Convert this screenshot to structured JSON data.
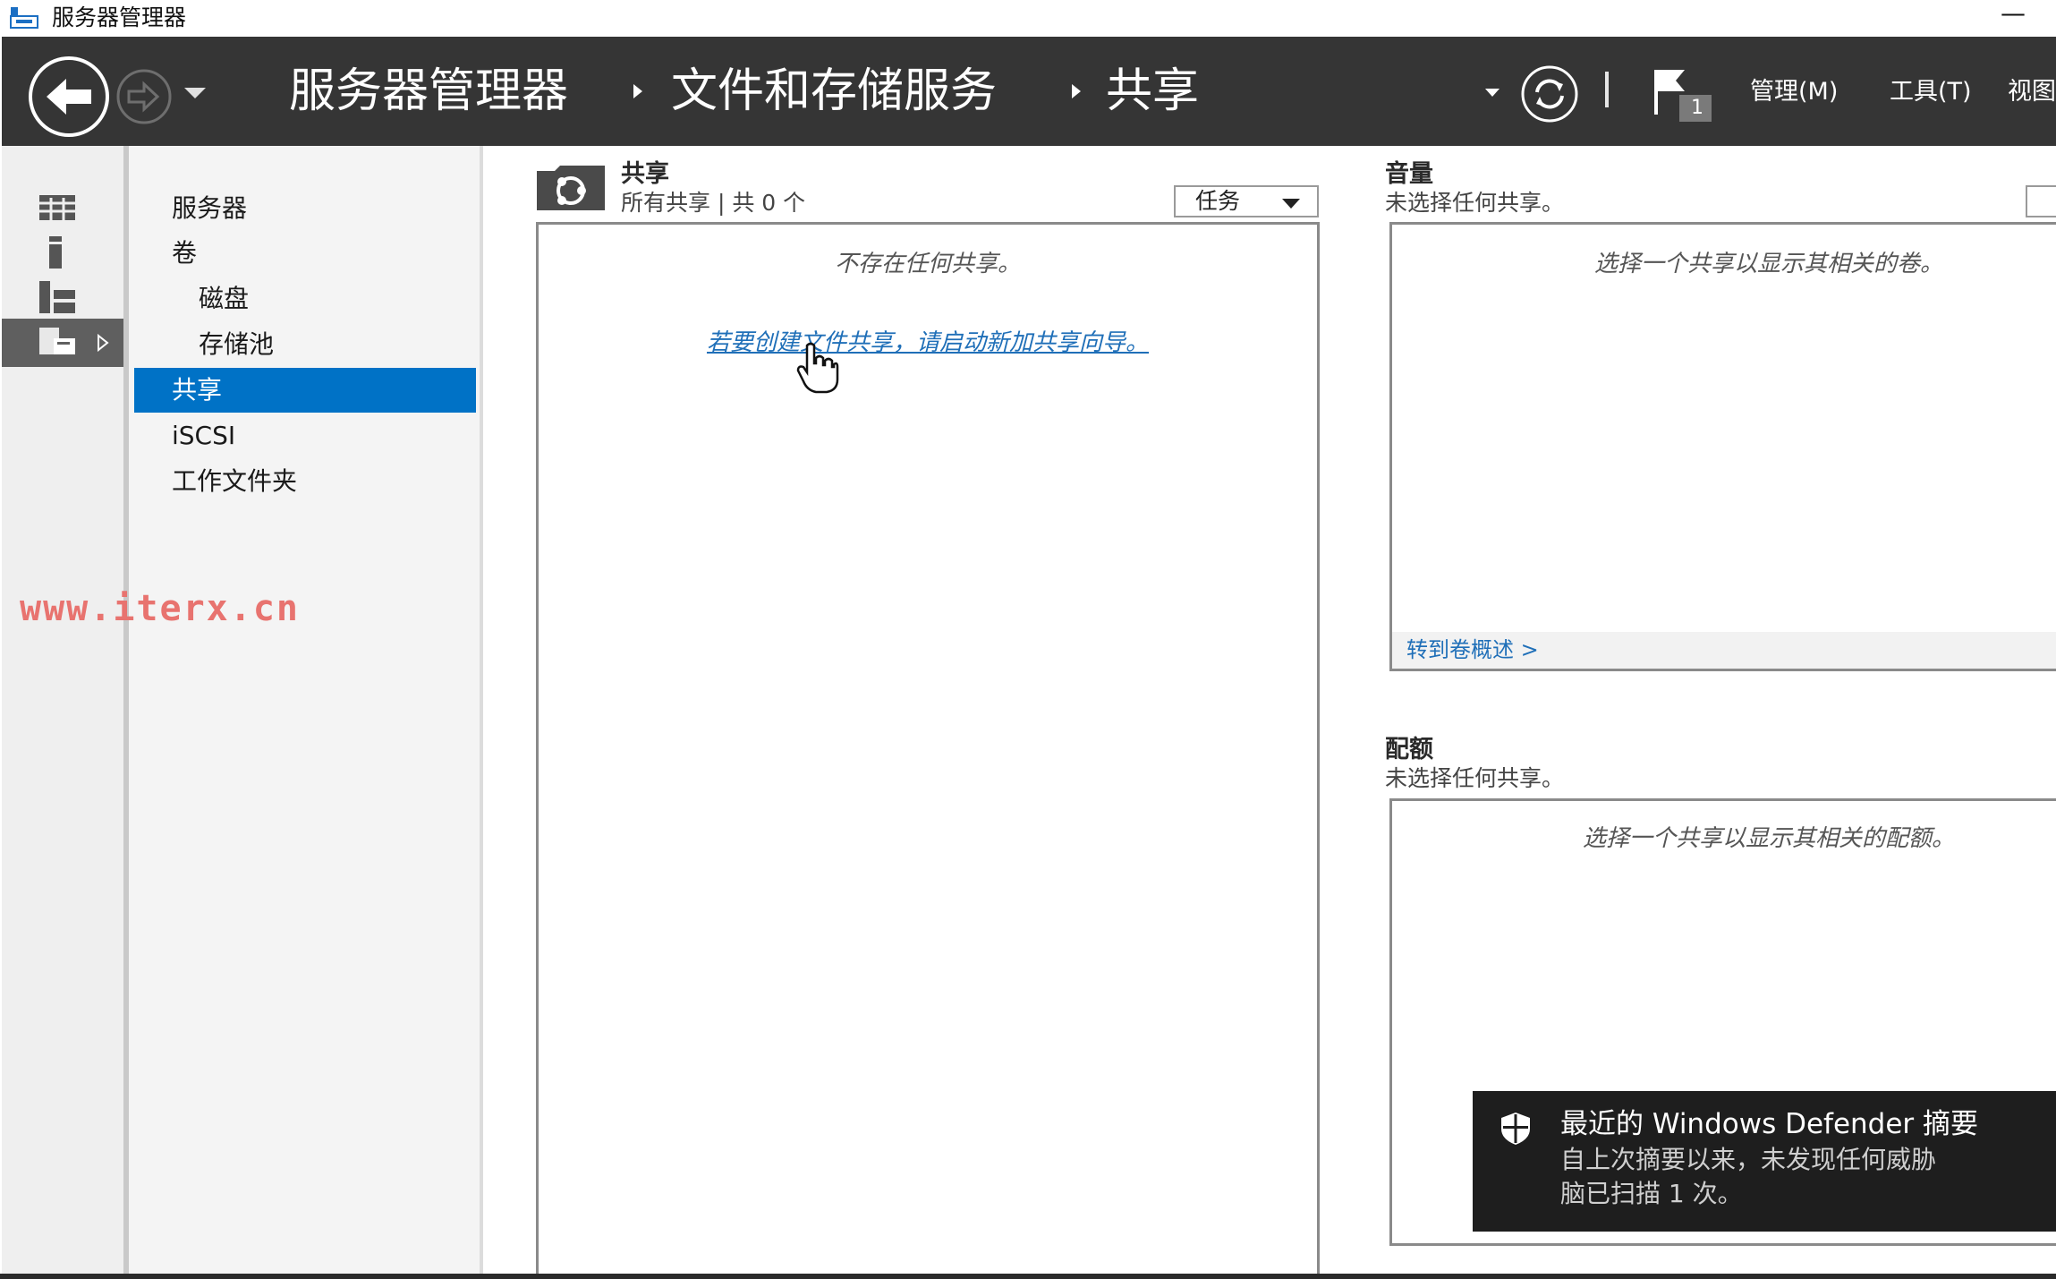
{
  "window": {
    "title": "服务器管理器",
    "minimize": "—"
  },
  "header": {
    "breadcrumb": [
      "服务器管理器",
      "文件和存储服务",
      "共享"
    ],
    "flag_count": "1",
    "menus": {
      "manage": "管理(M)",
      "tools": "工具(T)",
      "view": "视图"
    }
  },
  "nav": {
    "items": [
      {
        "label": "服务器"
      },
      {
        "label": "卷"
      },
      {
        "label": "磁盘"
      },
      {
        "label": "存储池"
      },
      {
        "label": "共享",
        "selected": true
      },
      {
        "label": "iSCSI"
      },
      {
        "label": "工作文件夹"
      }
    ]
  },
  "watermark": "www.iterx.cn",
  "shares": {
    "title": "共享",
    "subtitle": "所有共享 | 共 0 个",
    "tasks": "任务",
    "empty": "不存在任何共享。",
    "link": "若要创建文件共享，请启动新加共享向导。"
  },
  "volume": {
    "title": "音量",
    "subtitle": "未选择任何共享。",
    "empty": "选择一个共享以显示其相关的卷。",
    "link": "转到卷概述 >"
  },
  "quota": {
    "title": "配额",
    "subtitle": "未选择任何共享。",
    "empty": "选择一个共享以显示其相关的配额。"
  },
  "toast": {
    "title": "最近的 Windows Defender 摘要",
    "line1": "自上次摘要以来，未发现任何威胁",
    "line2": "脑已扫描 1 次。"
  },
  "colors": {
    "header": "#353535",
    "selected": "#0072c6",
    "link": "#1f6fb8",
    "toast": "#1e1e1e"
  }
}
